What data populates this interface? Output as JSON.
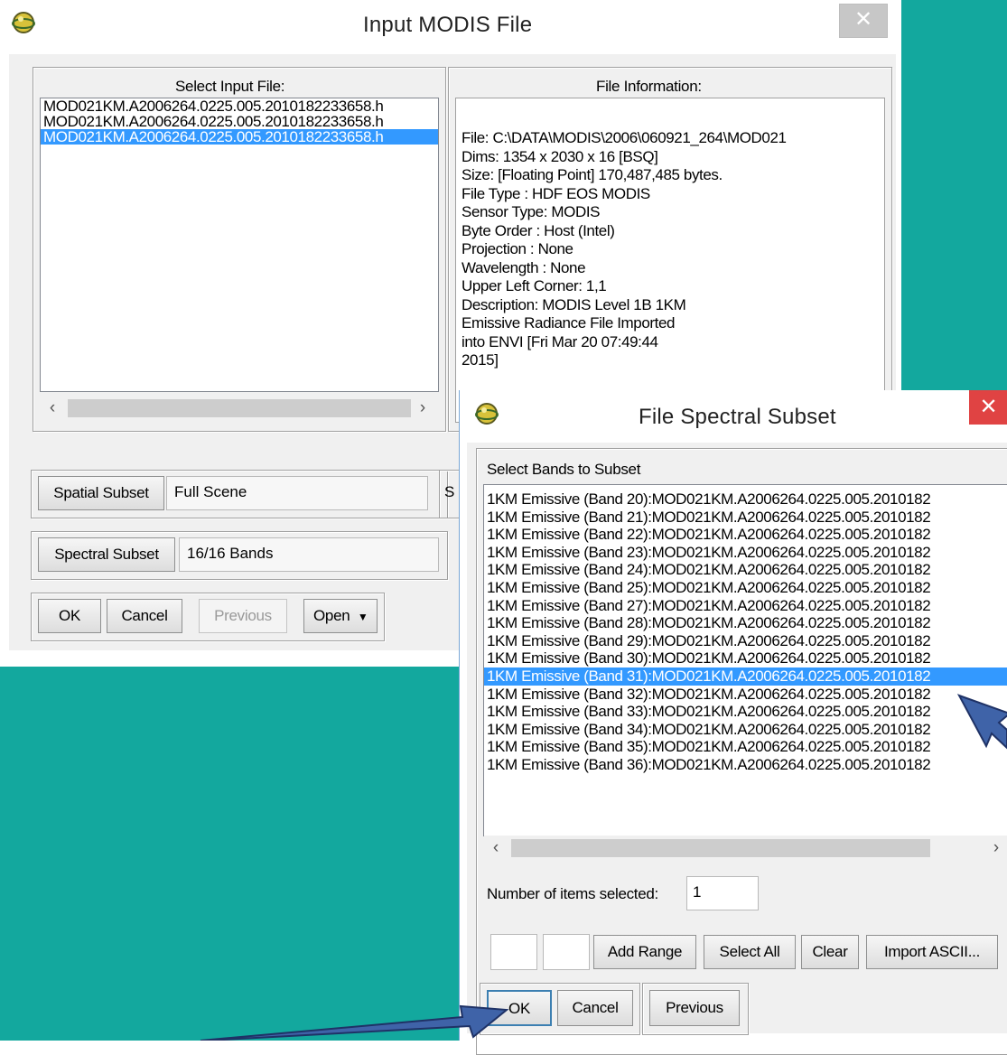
{
  "main_window": {
    "title": "Input MODIS File",
    "select_input_label": "Select Input File:",
    "files": [
      "MOD021KM.A2006264.0225.005.2010182233658.h",
      "MOD021KM.A2006264.0225.005.2010182233658.h",
      "MOD021KM.A2006264.0225.005.2010182233658.h"
    ],
    "selected_file_index": 2,
    "file_info_label": "File Information:",
    "file_info": [
      "File: C:\\DATA\\MODIS\\2006\\060921_264\\MOD021",
      "Dims: 1354 x 2030 x 16 [BSQ]",
      "Size: [Floating Point] 170,487,485 bytes.",
      "File Type  : HDF EOS MODIS",
      "Sensor Type: MODIS",
      "Byte Order : Host (Intel)",
      "Projection : None",
      "Wavelength : None",
      "Upper Left Corner: 1,1",
      "Description: MODIS Level 1B 1KM",
      "Emissive Radiance File Imported",
      "into ENVI [Fri Mar 20 07:49:44",
      "2015]"
    ],
    "spatial_subset_button": "Spatial Subset",
    "spatial_subset_value": "Full Scene",
    "spectral_subset_button": "Spectral Subset",
    "spectral_subset_value": "16/16 Bands",
    "hidden_button_fragment": "S",
    "buttons": {
      "ok": "OK",
      "cancel": "Cancel",
      "previous": "Previous",
      "open": "Open"
    }
  },
  "subset_dialog": {
    "title": "File Spectral Subset",
    "bands_label": "Select Bands to Subset",
    "bands": [
      "1KM Emissive (Band 20):MOD021KM.A2006264.0225.005.2010182",
      "1KM Emissive (Band 21):MOD021KM.A2006264.0225.005.2010182",
      "1KM Emissive (Band 22):MOD021KM.A2006264.0225.005.2010182",
      "1KM Emissive (Band 23):MOD021KM.A2006264.0225.005.2010182",
      "1KM Emissive (Band 24):MOD021KM.A2006264.0225.005.2010182",
      "1KM Emissive (Band 25):MOD021KM.A2006264.0225.005.2010182",
      "1KM Emissive (Band 27):MOD021KM.A2006264.0225.005.2010182",
      "1KM Emissive (Band 28):MOD021KM.A2006264.0225.005.2010182",
      "1KM Emissive (Band 29):MOD021KM.A2006264.0225.005.2010182",
      "1KM Emissive (Band 30):MOD021KM.A2006264.0225.005.2010182",
      "1KM Emissive (Band 31):MOD021KM.A2006264.0225.005.2010182",
      "1KM Emissive (Band 32):MOD021KM.A2006264.0225.005.2010182",
      "1KM Emissive (Band 33):MOD021KM.A2006264.0225.005.2010182",
      "1KM Emissive (Band 34):MOD021KM.A2006264.0225.005.2010182",
      "1KM Emissive (Band 35):MOD021KM.A2006264.0225.005.2010182",
      "1KM Emissive (Band 36):MOD021KM.A2006264.0225.005.2010182"
    ],
    "selected_band_index": 10,
    "items_selected_label": "Number of items selected:",
    "items_selected_value": "1",
    "range_from": "",
    "range_to": "",
    "buttons": {
      "add_range": "Add Range",
      "select_all": "Select All",
      "clear": "Clear",
      "import_ascii": "Import ASCII...",
      "ok": "OK",
      "cancel": "Cancel",
      "previous": "Previous"
    }
  },
  "colors": {
    "desktop": "#13a89e",
    "selection": "#3399ff",
    "close_button": "#e04343",
    "arrow": "#3f63a8"
  },
  "icons": [
    "envi-app-icon",
    "close-icon",
    "chevron-left-icon",
    "chevron-right-icon",
    "dropdown-arrow-icon",
    "annotation-arrow-icon"
  ]
}
